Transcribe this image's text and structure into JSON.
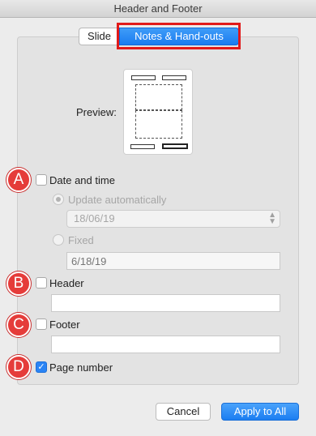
{
  "window": {
    "title": "Header and Footer"
  },
  "tabs": {
    "slide": "Slide",
    "notes": "Notes & Hand-outs"
  },
  "preview": {
    "label": "Preview:"
  },
  "badges": {
    "a": "A",
    "b": "B",
    "c": "C",
    "d": "D"
  },
  "date_time": {
    "label": "Date and time",
    "checked": false,
    "update_label": "Update automatically",
    "update_selected": true,
    "update_value": "18/06/19",
    "fixed_label": "Fixed",
    "fixed_placeholder": "6/18/19"
  },
  "header": {
    "label": "Header",
    "checked": false,
    "value": ""
  },
  "footer": {
    "label": "Footer",
    "checked": false,
    "value": ""
  },
  "page_number": {
    "label": "Page number",
    "checked": true
  },
  "buttons": {
    "cancel": "Cancel",
    "apply": "Apply to All"
  },
  "colors": {
    "accent": "#1a7cf0",
    "badge": "#e53c3a",
    "highlight": "#e21a1a"
  },
  "icons": {
    "checkmark": "checkmark-icon",
    "select_arrows": "chevron-updown-icon"
  }
}
